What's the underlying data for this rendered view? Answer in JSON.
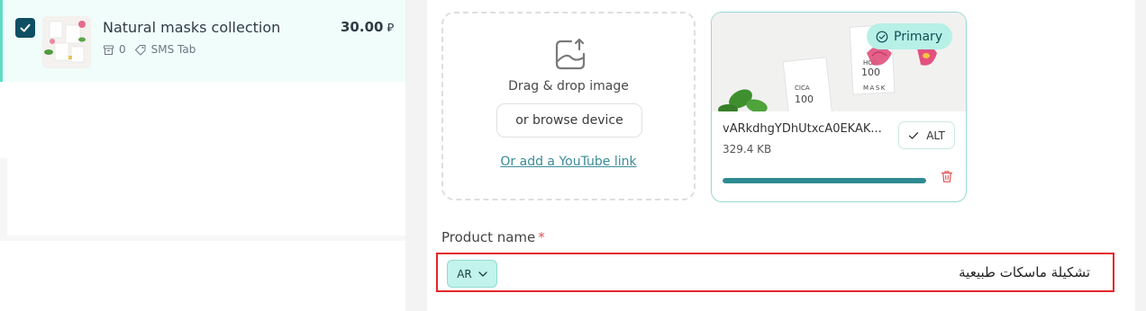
{
  "product_list": {
    "item": {
      "title": "Natural masks collection",
      "stock_count": "0",
      "tag": "SMS Tab",
      "price": "30.00",
      "currency_symbol": "⃁"
    }
  },
  "images": {
    "dropzone": {
      "instruction": "Drag & drop image",
      "browse_label": "or browse device",
      "youtube_link": "Or add a YouTube link"
    },
    "uploaded": {
      "badge": "Primary",
      "file_name": "vARkdhgYDhUtxcA0EKAK...",
      "file_size": "329.4 KB",
      "alt_label": "ALT",
      "upload_progress": 1.0,
      "preview_text": [
        "HOD",
        "CICA",
        "100",
        "MASK"
      ]
    }
  },
  "product_name": {
    "label": "Product name",
    "required_mark": "*",
    "language": "AR",
    "value": "تشكيلة ماسكات طبيعية"
  },
  "colors": {
    "accent": "#2f8a91",
    "selected_row_bg": "#f0fdfb",
    "checkbox": "#0f4f63",
    "badge_bg": "#b7f0e7",
    "error_border": "#e5252a",
    "required": "#e05252"
  }
}
